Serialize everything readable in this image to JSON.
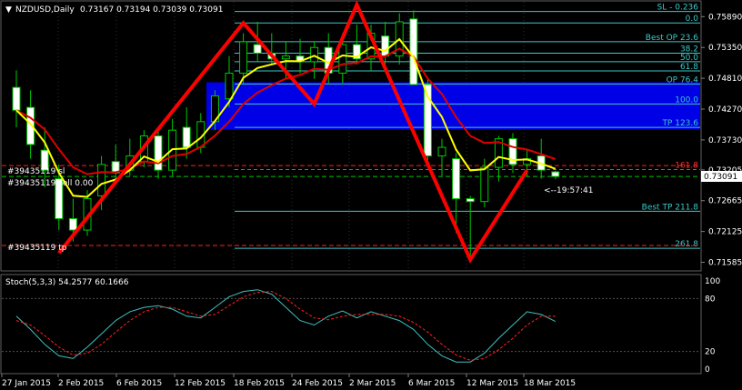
{
  "header": {
    "arrow": "▼",
    "symbol": "NZDUSD,Daily",
    "ohlc": "0.73167 0.73194 0.73039 0.73091"
  },
  "price_scale": {
    "labels": [
      "0.75890",
      "0.75350",
      "0.74810",
      "0.74270",
      "0.73730",
      "0.73205",
      "0.72665",
      "0.72125",
      "0.71585"
    ],
    "current_price": "0.73091"
  },
  "time_scale": {
    "labels": [
      "27 Jan 2015",
      "2 Feb 2015",
      "6 Feb 2015",
      "12 Feb 2015",
      "18 Feb 2015",
      "24 Feb 2015",
      "2 Mar 2015",
      "6 Mar 2015",
      "12 Mar 2015",
      "18 Mar 2015"
    ]
  },
  "countdown": "<--19:57:41",
  "fib_levels": [
    {
      "label": "SL - 0.236",
      "color": "#3cc8c8"
    },
    {
      "label": "0.0",
      "color": "#3cc8c8"
    },
    {
      "label": "Best OP 23.6",
      "color": "#3cc8c8"
    },
    {
      "label": "38.2",
      "color": "#3cc8c8"
    },
    {
      "label": "50.0",
      "color": "#3cc8c8"
    },
    {
      "label": "61.8",
      "color": "#3cc8c8"
    },
    {
      "label": "OP 76.4",
      "color": "#3cc8c8"
    },
    {
      "label": "100.0",
      "color": "#3cc8c8"
    },
    {
      "label": "TP 123.6",
      "color": "#3cc8c8"
    },
    {
      "label": "161.8",
      "color": "#ff3030"
    },
    {
      "label": "Best TP 211.8",
      "color": "#3cc8c8"
    },
    {
      "label": "261.8",
      "color": "#3cc8c8"
    }
  ],
  "order_labels": {
    "sl": "#39435119 sl",
    "sell": "#39435119 sell 0.00",
    "tp": "#39435119 tp"
  },
  "stoch": {
    "title": "Stoch(5,3,3) 54.2577 60.1666",
    "levels": [
      "100",
      "80",
      "20",
      "0"
    ]
  },
  "colors": {
    "background": "#000000",
    "candle_up": "#ffffff",
    "candle_down": "#ffffff",
    "wick": "#00c800",
    "ma_fast": "#ffff00",
    "ma_slow": "#e00000",
    "zone": "#0000ff",
    "zigzag": "#ff0000",
    "stoch_main": "#40c0c0",
    "stoch_signal": "#ff2020",
    "grid": "#303030",
    "axis_text": "#ffffff"
  },
  "chart_data": {
    "type": "candlestick",
    "symbol": "NZDUSD",
    "timeframe": "Daily",
    "ylim": [
      0.7145,
      0.7615
    ],
    "candles": [
      {
        "o": 0.7465,
        "h": 0.7495,
        "l": 0.7395,
        "c": 0.7425
      },
      {
        "o": 0.743,
        "h": 0.746,
        "l": 0.734,
        "c": 0.7365
      },
      {
        "o": 0.7355,
        "h": 0.7395,
        "l": 0.729,
        "c": 0.732
      },
      {
        "o": 0.7305,
        "h": 0.733,
        "l": 0.7215,
        "c": 0.7235
      },
      {
        "o": 0.7235,
        "h": 0.727,
        "l": 0.7195,
        "c": 0.7215
      },
      {
        "o": 0.7215,
        "h": 0.7285,
        "l": 0.7205,
        "c": 0.727
      },
      {
        "o": 0.7275,
        "h": 0.7345,
        "l": 0.725,
        "c": 0.733
      },
      {
        "o": 0.7335,
        "h": 0.7365,
        "l": 0.73,
        "c": 0.7315
      },
      {
        "o": 0.732,
        "h": 0.7375,
        "l": 0.731,
        "c": 0.7345
      },
      {
        "o": 0.7335,
        "h": 0.739,
        "l": 0.7325,
        "c": 0.738
      },
      {
        "o": 0.738,
        "h": 0.7395,
        "l": 0.7305,
        "c": 0.732
      },
      {
        "o": 0.732,
        "h": 0.741,
        "l": 0.731,
        "c": 0.739
      },
      {
        "o": 0.7395,
        "h": 0.743,
        "l": 0.734,
        "c": 0.736
      },
      {
        "o": 0.736,
        "h": 0.742,
        "l": 0.735,
        "c": 0.7405
      },
      {
        "o": 0.7405,
        "h": 0.746,
        "l": 0.739,
        "c": 0.745
      },
      {
        "o": 0.7445,
        "h": 0.752,
        "l": 0.743,
        "c": 0.749
      },
      {
        "o": 0.749,
        "h": 0.756,
        "l": 0.747,
        "c": 0.7545
      },
      {
        "o": 0.754,
        "h": 0.758,
        "l": 0.751,
        "c": 0.7525
      },
      {
        "o": 0.7525,
        "h": 0.756,
        "l": 0.7505,
        "c": 0.7515
      },
      {
        "o": 0.7515,
        "h": 0.7545,
        "l": 0.748,
        "c": 0.752
      },
      {
        "o": 0.752,
        "h": 0.755,
        "l": 0.749,
        "c": 0.751
      },
      {
        "o": 0.751,
        "h": 0.7545,
        "l": 0.748,
        "c": 0.7535
      },
      {
        "o": 0.7535,
        "h": 0.756,
        "l": 0.747,
        "c": 0.749
      },
      {
        "o": 0.749,
        "h": 0.756,
        "l": 0.747,
        "c": 0.754
      },
      {
        "o": 0.754,
        "h": 0.7575,
        "l": 0.7505,
        "c": 0.7515
      },
      {
        "o": 0.7515,
        "h": 0.7575,
        "l": 0.7495,
        "c": 0.756
      },
      {
        "o": 0.7555,
        "h": 0.758,
        "l": 0.75,
        "c": 0.752
      },
      {
        "o": 0.752,
        "h": 0.7595,
        "l": 0.7505,
        "c": 0.758
      },
      {
        "o": 0.7585,
        "h": 0.76,
        "l": 0.75,
        "c": 0.747
      },
      {
        "o": 0.747,
        "h": 0.748,
        "l": 0.733,
        "c": 0.7345
      },
      {
        "o": 0.7345,
        "h": 0.7375,
        "l": 0.731,
        "c": 0.736
      },
      {
        "o": 0.734,
        "h": 0.735,
        "l": 0.721,
        "c": 0.727
      },
      {
        "o": 0.727,
        "h": 0.7275,
        "l": 0.716,
        "c": 0.7265
      },
      {
        "o": 0.7265,
        "h": 0.734,
        "l": 0.7255,
        "c": 0.7325
      },
      {
        "o": 0.7325,
        "h": 0.738,
        "l": 0.73,
        "c": 0.7375
      },
      {
        "o": 0.7375,
        "h": 0.7385,
        "l": 0.7315,
        "c": 0.733
      },
      {
        "o": 0.733,
        "h": 0.7355,
        "l": 0.731,
        "c": 0.734
      },
      {
        "o": 0.7345,
        "h": 0.7375,
        "l": 0.7305,
        "c": 0.732
      },
      {
        "o": 0.7317,
        "h": 0.7319,
        "l": 0.7304,
        "c": 0.7309
      }
    ],
    "zigzag": [
      {
        "i": 3,
        "y": 0.7175
      },
      {
        "i": 16,
        "y": 0.7578
      },
      {
        "i": 21,
        "y": 0.7436
      },
      {
        "i": 24,
        "y": 0.761
      },
      {
        "i": 32,
        "y": 0.7163
      },
      {
        "i": 36,
        "y": 0.732
      }
    ],
    "fib_values": [
      0.7598,
      0.7578,
      0.7545,
      0.7525,
      0.751,
      0.7494,
      0.7471,
      0.7436,
      0.7395,
      0.7321,
      0.7248,
      0.7183
    ],
    "zone": {
      "top": 0.7474,
      "bottom": 0.7391
    },
    "order_lines": {
      "sl": 0.7328,
      "sell": 0.7309,
      "tp": 0.7188
    },
    "stochastic": {
      "main": [
        60,
        45,
        28,
        15,
        12,
        25,
        40,
        55,
        65,
        70,
        72,
        68,
        60,
        58,
        70,
        82,
        88,
        90,
        85,
        70,
        55,
        50,
        60,
        66,
        58,
        65,
        60,
        55,
        45,
        28,
        15,
        8,
        8,
        18,
        35,
        50,
        65,
        62,
        54
      ],
      "signal": [
        55,
        50,
        38,
        25,
        16,
        18,
        28,
        42,
        55,
        65,
        70,
        70,
        65,
        60,
        62,
        72,
        82,
        87,
        88,
        80,
        68,
        58,
        56,
        60,
        62,
        62,
        62,
        60,
        53,
        42,
        28,
        16,
        10,
        12,
        22,
        35,
        50,
        60,
        60
      ]
    }
  }
}
